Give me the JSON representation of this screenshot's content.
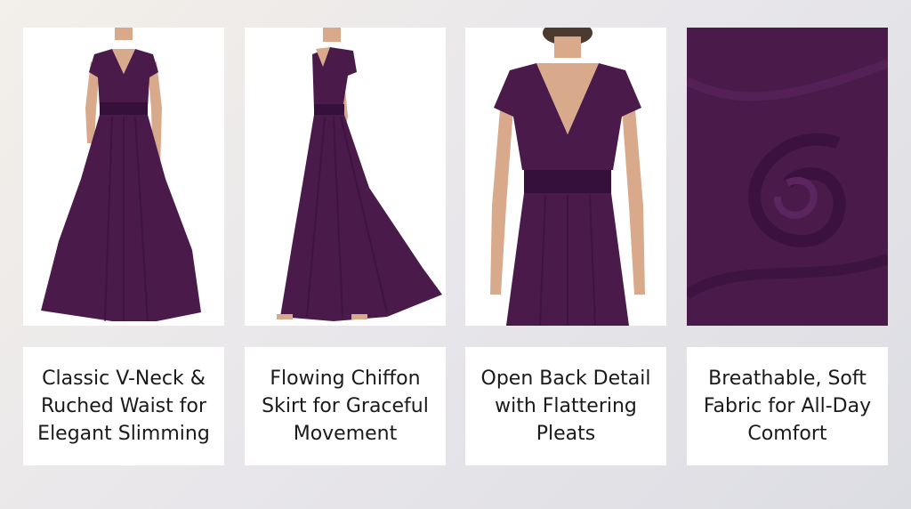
{
  "colors": {
    "dress": "#4a1a4a",
    "dress_dark": "#35103a",
    "dress_light": "#5d2560",
    "skin": "#d9a98c",
    "hair": "#4a3a30",
    "panel_bg": "#ffffff",
    "text": "#1a1a1a"
  },
  "panels": [
    {
      "image_alt": "front view dress",
      "caption": "Classic V-Neck &\nRuched Waist for\nElegant Slimming"
    },
    {
      "image_alt": "side view dress",
      "caption": "Flowing Chiffon\nSkirt for Graceful\nMovement"
    },
    {
      "image_alt": "back view dress",
      "caption": "Open Back Detail\nwith Flattering\nPleats"
    },
    {
      "image_alt": "fabric swirl",
      "caption": "Breathable, Soft\nFabric for All-Day\nComfort"
    }
  ]
}
